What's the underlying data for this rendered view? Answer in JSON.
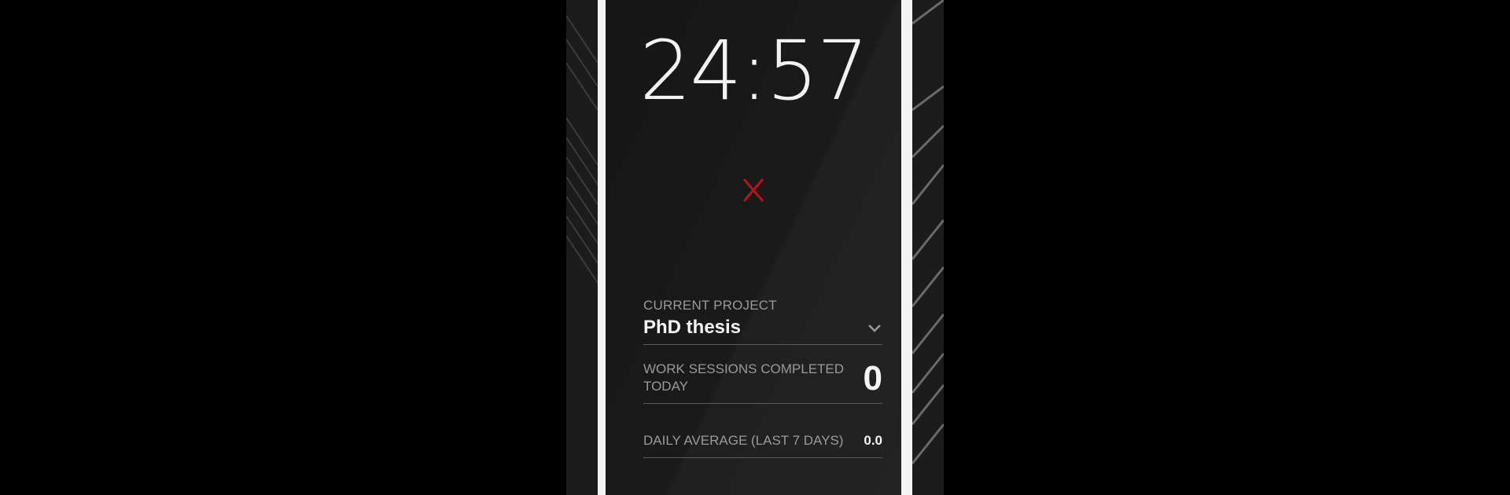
{
  "timer": {
    "display": "24:57"
  },
  "cancel": {
    "icon": "close-icon",
    "color": "#b3151b"
  },
  "project": {
    "label": "CURRENT PROJECT",
    "name": "PhD thesis",
    "icon": "chevron-down-icon"
  },
  "stats": {
    "sessions_label": "WORK SESSIONS COMPLETED TODAY",
    "sessions_value": "0",
    "average_label": "DAILY AVERAGE (LAST 7 DAYS)",
    "average_value": "0.0"
  },
  "colors": {
    "background": "#000000",
    "screen": "#1a1a1a",
    "frame": "#f4f4f4",
    "text_primary": "#f5f5f5",
    "text_secondary": "#9a9a9a",
    "accent": "#b3151b"
  }
}
